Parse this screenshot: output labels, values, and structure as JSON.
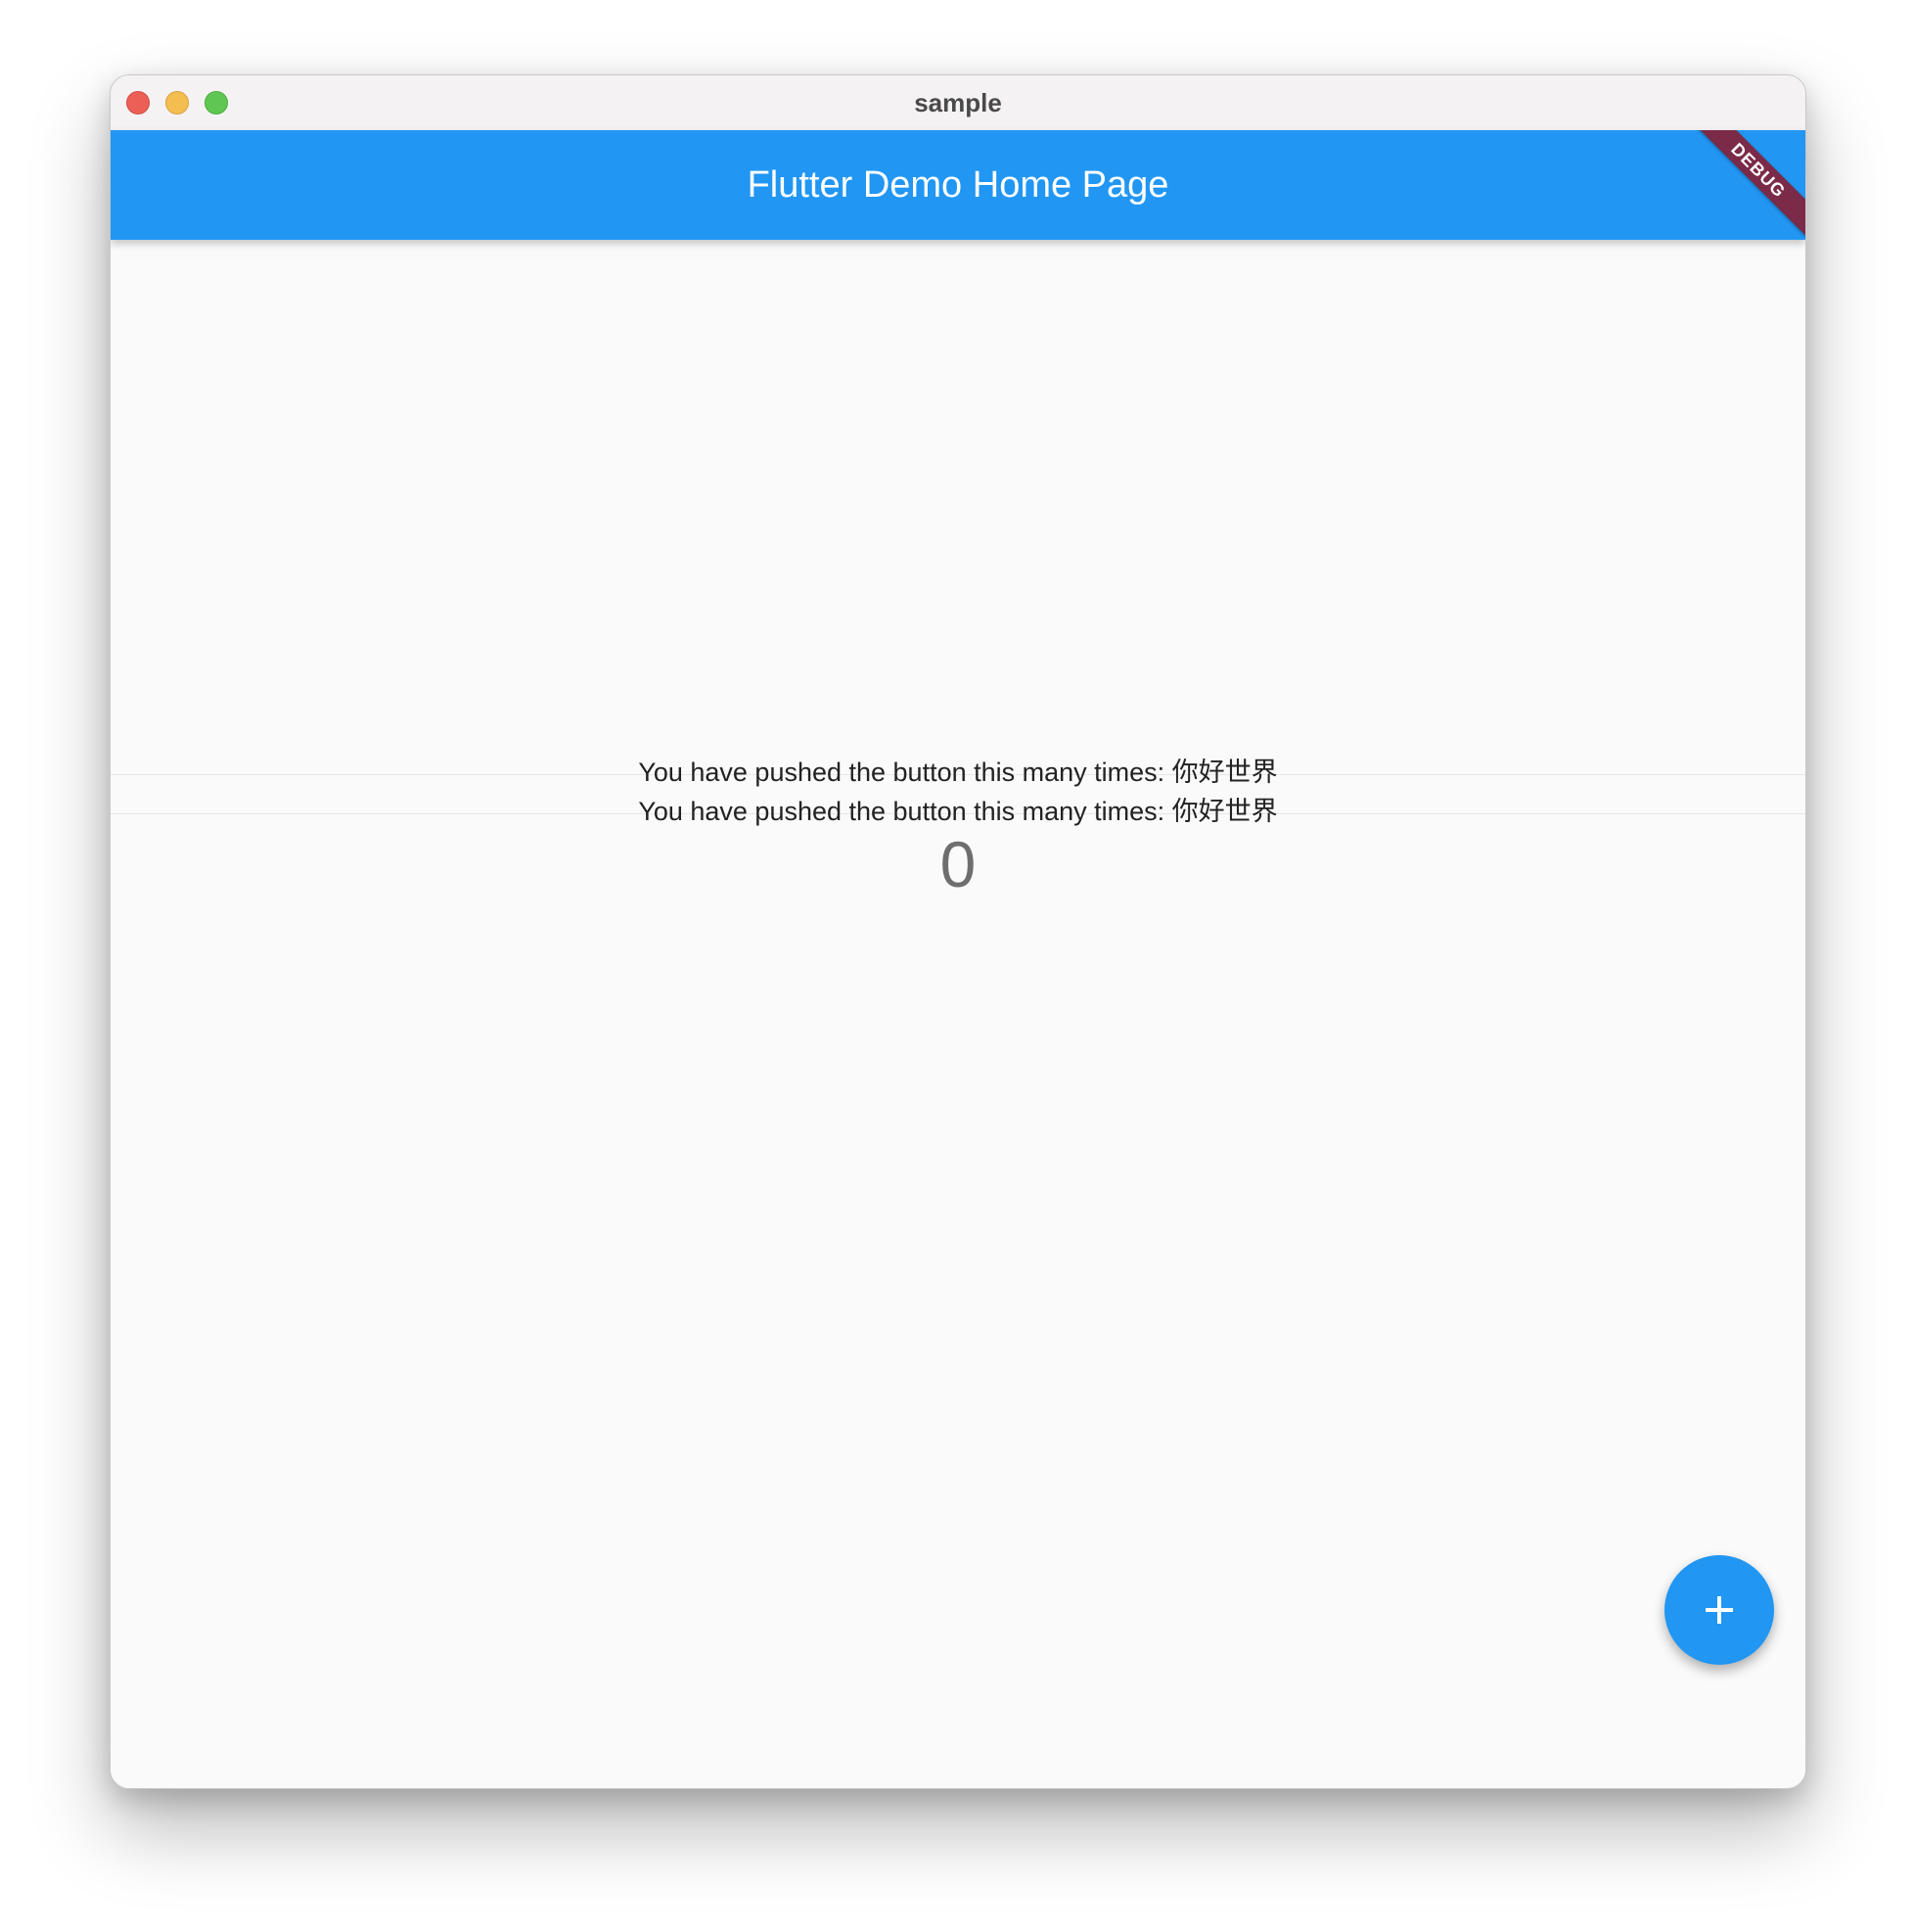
{
  "window": {
    "title": "sample"
  },
  "appbar": {
    "title": "Flutter Demo Home Page",
    "debug_banner": "DEBUG"
  },
  "body": {
    "label_1": "You have pushed the button this many times: 你好世界",
    "label_2": "You have pushed the button this many times: 你好世界",
    "counter": "0"
  },
  "fab": {
    "icon": "plus-icon"
  },
  "colors": {
    "primary": "#2196f3",
    "debug_banner": "#7b2a47",
    "background": "#fafafa"
  }
}
